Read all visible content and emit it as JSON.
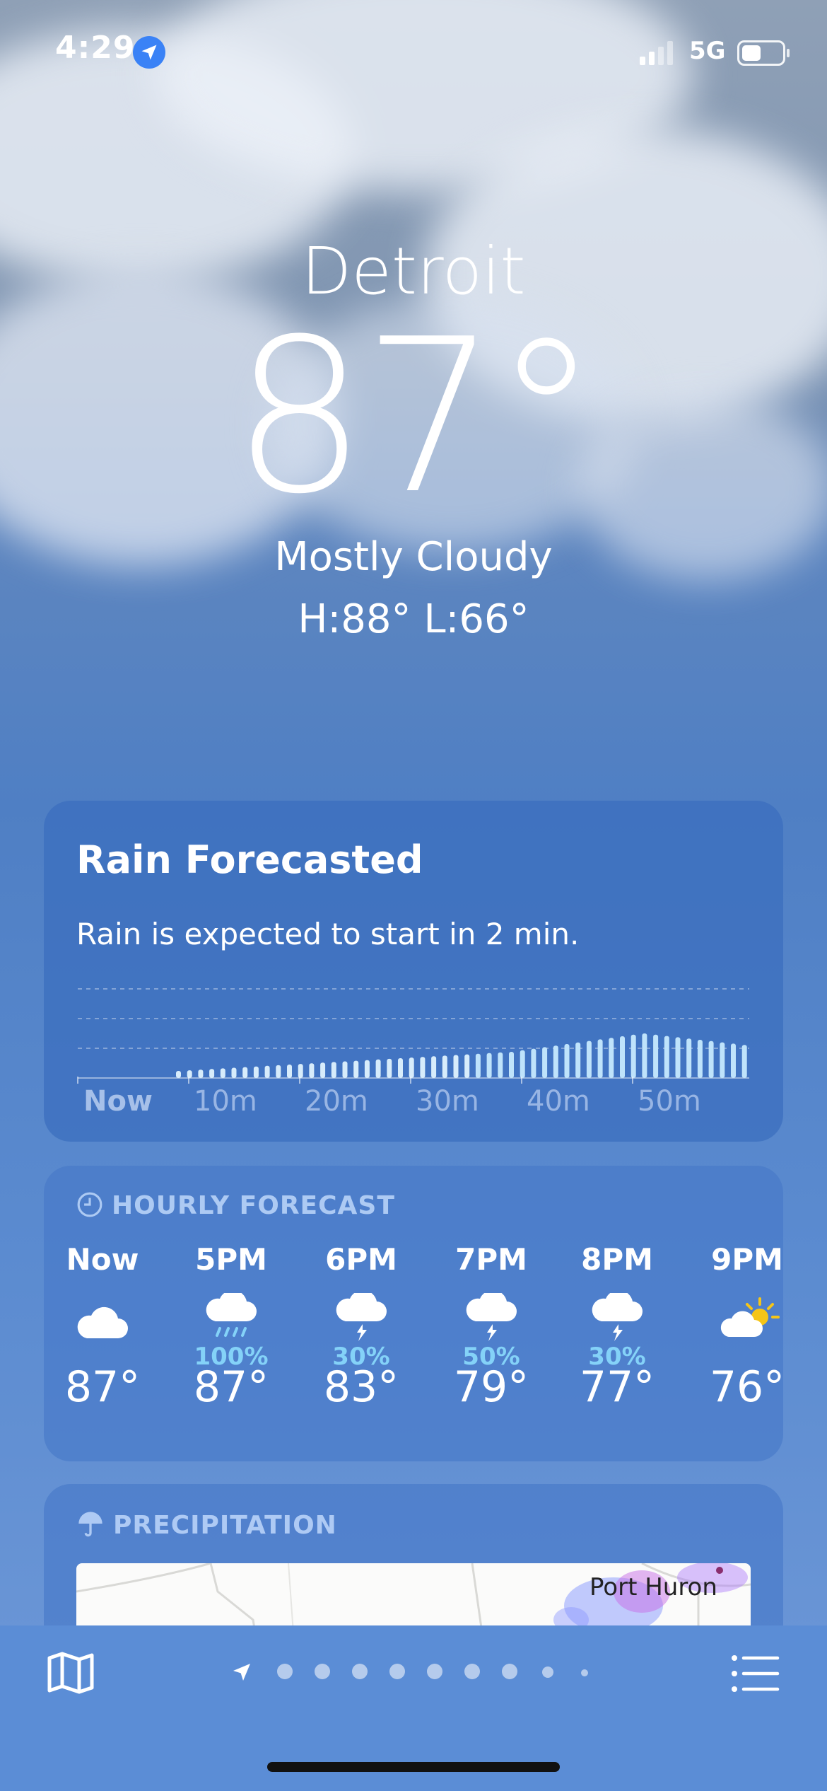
{
  "status_bar": {
    "time": "4:29",
    "network": "5G"
  },
  "current": {
    "city": "Detroit",
    "temperature": "87°",
    "condition": "Mostly Cloudy",
    "high_low": "H:88°  L:66°"
  },
  "rain_card": {
    "title": "Rain Forecasted",
    "subtitle": "Rain is expected to start in 2 min.",
    "axis": [
      "Now",
      "10m",
      "20m",
      "30m",
      "40m",
      "50m"
    ]
  },
  "hourly": {
    "header": "HOURLY FORECAST",
    "items": [
      {
        "label": "Now",
        "icon": "cloud-icon",
        "chance": "",
        "temp": "87°"
      },
      {
        "label": "5PM",
        "icon": "cloud-rain-icon",
        "chance": "100%",
        "temp": "87°"
      },
      {
        "label": "6PM",
        "icon": "cloud-bolt-icon",
        "chance": "30%",
        "temp": "83°"
      },
      {
        "label": "7PM",
        "icon": "cloud-bolt-icon",
        "chance": "50%",
        "temp": "79°"
      },
      {
        "label": "8PM",
        "icon": "cloud-bolt-icon",
        "chance": "30%",
        "temp": "77°"
      },
      {
        "label": "9PM",
        "icon": "cloud-sun-icon",
        "chance": "",
        "temp": "76°"
      }
    ]
  },
  "precipitation": {
    "header": "PRECIPITATION",
    "map_label": "Port Huron"
  },
  "colors": {
    "chance": "#84d2f8",
    "location_badge": "#3a82f6",
    "sun": "#f5c518"
  }
}
